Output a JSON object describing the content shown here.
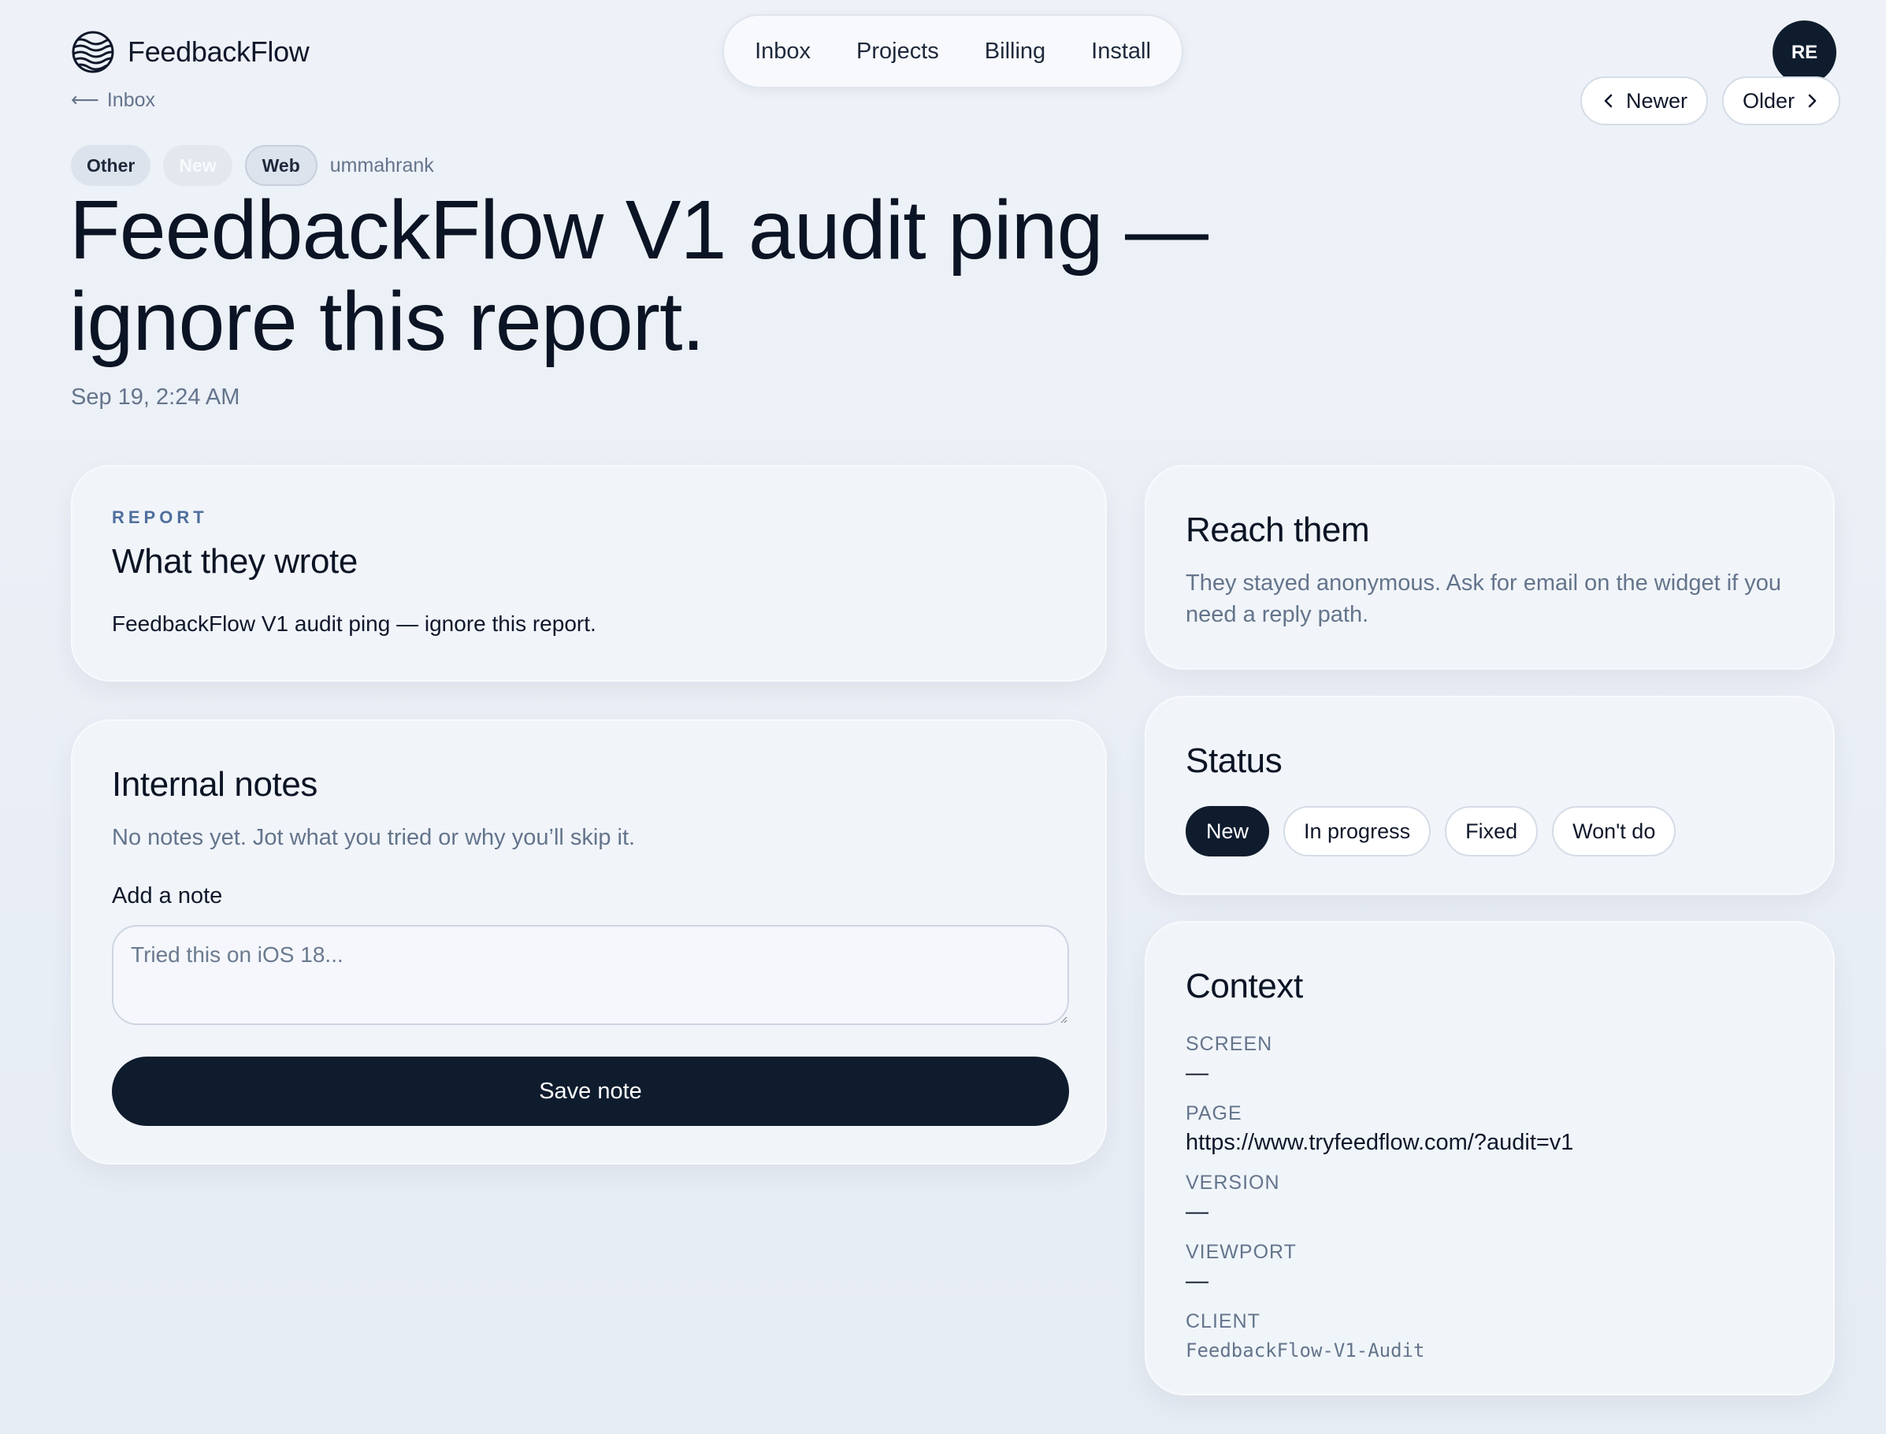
{
  "brand": {
    "name": "FeedbackFlow",
    "logo_icon": "wave-globe-icon"
  },
  "nav": {
    "items": [
      "Inbox",
      "Projects",
      "Billing",
      "Install"
    ]
  },
  "user": {
    "initials": "RE"
  },
  "back": {
    "arrow": "⟵",
    "label": "Inbox"
  },
  "pager": {
    "newer": "Newer",
    "older": "Older"
  },
  "report": {
    "tags": {
      "category": "Other",
      "status": "New",
      "platform": "Web",
      "user": "ummahrank"
    },
    "title": "FeedbackFlow V1 audit ping — ignore this report.",
    "date": "Sep 19, 2:24 AM"
  },
  "report_card": {
    "eyebrow": "REPORT",
    "heading": "What they wrote",
    "body": "FeedbackFlow V1 audit ping — ignore this report."
  },
  "notes_card": {
    "heading": "Internal notes",
    "empty": "No notes yet. Jot what you tried or why you’ll skip it.",
    "label": "Add a note",
    "placeholder": "Tried this on iOS 18...",
    "value": "",
    "save": "Save note"
  },
  "reach_card": {
    "heading": "Reach them",
    "body": "They stayed anonymous. Ask for email on the widget if you need a reply path."
  },
  "status_card": {
    "heading": "Status",
    "options": [
      "New",
      "In progress",
      "Fixed",
      "Won't do"
    ],
    "selected": "New"
  },
  "context_card": {
    "heading": "Context",
    "fields": [
      {
        "key": "SCREEN",
        "value": "—"
      },
      {
        "key": "PAGE",
        "value": "https://www.tryfeedflow.com/?audit=v1"
      },
      {
        "key": "VERSION",
        "value": "—"
      },
      {
        "key": "VIEWPORT",
        "value": "—"
      },
      {
        "key": "CLIENT",
        "value": "FeedbackFlow-V1-Audit"
      }
    ]
  },
  "colors": {
    "primary": "#0f1c2e",
    "muted": "#64748b",
    "eyebrow": "#4f6f9b",
    "background": "#eef2f8"
  }
}
